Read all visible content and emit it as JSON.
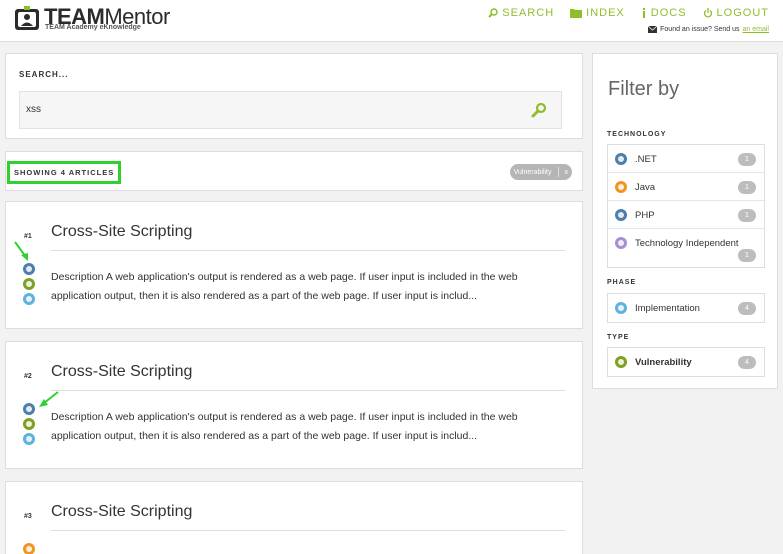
{
  "header": {
    "brand_bold": "TEAM",
    "brand_regular": "Mentor",
    "tagline": "TEAM Academy eKnowledge",
    "nav": [
      {
        "label": "SEARCH",
        "icon": "search-icon"
      },
      {
        "label": "INDEX",
        "icon": "folder-icon"
      },
      {
        "label": "DOCS",
        "icon": "info-icon"
      },
      {
        "label": "LOGOUT",
        "icon": "power-icon"
      }
    ],
    "issue_text": "Found an issue? Send us",
    "issue_link": "an email",
    "accent": "#8fbe2b"
  },
  "search": {
    "label": "SEARCH...",
    "value": "xss"
  },
  "results": {
    "showing": "SHOWING 4 ARTICLES",
    "tag_label": "Vulnerability",
    "tag_close": "x"
  },
  "articles": [
    {
      "number": "#1",
      "title": "Cross-Site Scripting",
      "description_1": "Description A web application's output is rendered as a web page. If user input is included in the web",
      "description_2": "application output, then it is also rendered as a part of the web page. If user input is includ..."
    },
    {
      "number": "#2",
      "title": "Cross-Site Scripting",
      "description_1": "Description A web application's output is rendered as a web page. If user input is included in the web",
      "description_2": "application output, then it is also rendered as a part of the web page. If user input is includ..."
    },
    {
      "number": "#3",
      "title": "Cross-Site Scripting"
    }
  ],
  "filter": {
    "title": "Filter by",
    "technology_label": "TECHNOLOGY",
    "technology": [
      {
        "label": ".NET",
        "count": "1"
      },
      {
        "label": "Java",
        "count": "1"
      },
      {
        "label": "PHP",
        "count": "1"
      },
      {
        "label": "Technology Independent",
        "count": "1"
      }
    ],
    "phase_label": "PHASE",
    "phase": [
      {
        "label": "Implementation",
        "count": "4"
      }
    ],
    "type_label": "TYPE",
    "type": [
      {
        "label": "Vulnerability",
        "count": "4"
      }
    ]
  },
  "colors": {
    "highlight": "#2ed12e",
    "annotation_arrow": "#2ed12e"
  }
}
